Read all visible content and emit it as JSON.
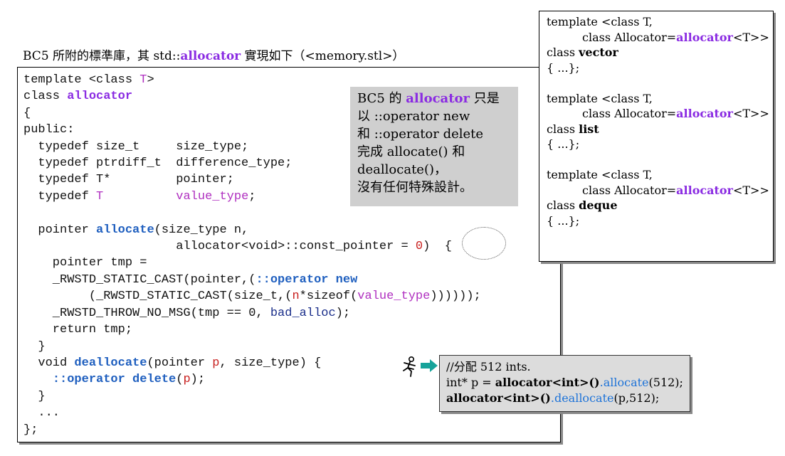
{
  "caption": {
    "pre": "BC5 所附的標準庫，其 std::",
    "kw": "allocator",
    "post": " 實現如下（<memory.stl>）"
  },
  "code": {
    "l1a": "template <class ",
    "l1b": "T",
    "l1c": ">",
    "l2a": "class ",
    "l2b": "allocator",
    "l3": "{",
    "l4": "public:",
    "l5": "  typedef size_t     size_type;",
    "l6": "  typedef ptrdiff_t  difference_type;",
    "l7": "  typedef T*         pointer;",
    "l8a": "  typedef ",
    "l8b": "T",
    "l8c": "          ",
    "l8d": "value_type",
    "l8e": ";",
    "l9a": "  pointer ",
    "l9b": "allocate",
    "l9c": "(size_type n,",
    "l10a": "                     allocator<void>::const_pointer ",
    "l10b": "= ",
    "l10c": "0",
    "l10d": ")  {",
    "l11": "    pointer tmp =",
    "l12a": "    _RWSTD_STATIC_CAST(pointer,(",
    "l12b": "::operator new",
    "l13a": "         (_RWSTD_STATIC_CAST(size_t,(",
    "l13b": "n",
    "l13c": "*sizeof(",
    "l13d": "value_type",
    "l13e": "))))));",
    "l14a": "    _RWSTD_THROW_NO_MSG(tmp == 0, ",
    "l14b": "bad_alloc",
    "l14c": ");",
    "l15": "    return tmp;",
    "l16": "  }",
    "l17a": "  void ",
    "l17b": "deallocate",
    "l17c": "(pointer ",
    "l17d": "p",
    "l17e": ", size_type) {",
    "l18a": "    ",
    "l18b": "::operator delete",
    "l18c": "(",
    "l18d": "p",
    "l18e": ");",
    "l19": "  }",
    "l20": "  ...",
    "l21": "};"
  },
  "note": {
    "l1a": "BC5 的 ",
    "l1b": "allocator",
    "l1c": " 只是",
    "l2": "以 ::operator new",
    "l3": "和 ::operator delete",
    "l4": "完成 allocate() 和",
    "l5": "deallocate()，",
    "l6": "沒有任何特殊設計。"
  },
  "side": {
    "t1": "template <class T,",
    "a_pre": "class Allocator=",
    "a_kw": "allocator",
    "a_post": "<T>>",
    "cls": "class ",
    "vector": "vector",
    "list": "list",
    "deque": "deque",
    "body": "{ ...};"
  },
  "usage": {
    "l1": "//分配 512 ints.",
    "l2a": "int* p = ",
    "l2b": "allocator<int>()",
    "l2c": ".allocate",
    "l2d": "(512);",
    "l3a": "allocator<int>()",
    "l3b": ".deallocate",
    "l3c": "(p,512);"
  },
  "colors": {
    "keyword": "#8a2be2",
    "type_param": "#b030c0",
    "literal": "#c8201f",
    "operator": "#1f5fbf",
    "arrow": "#16a39a",
    "note_bg": "#cfcfcf"
  },
  "icons": [
    "runner-icon",
    "arrow-right-icon"
  ]
}
